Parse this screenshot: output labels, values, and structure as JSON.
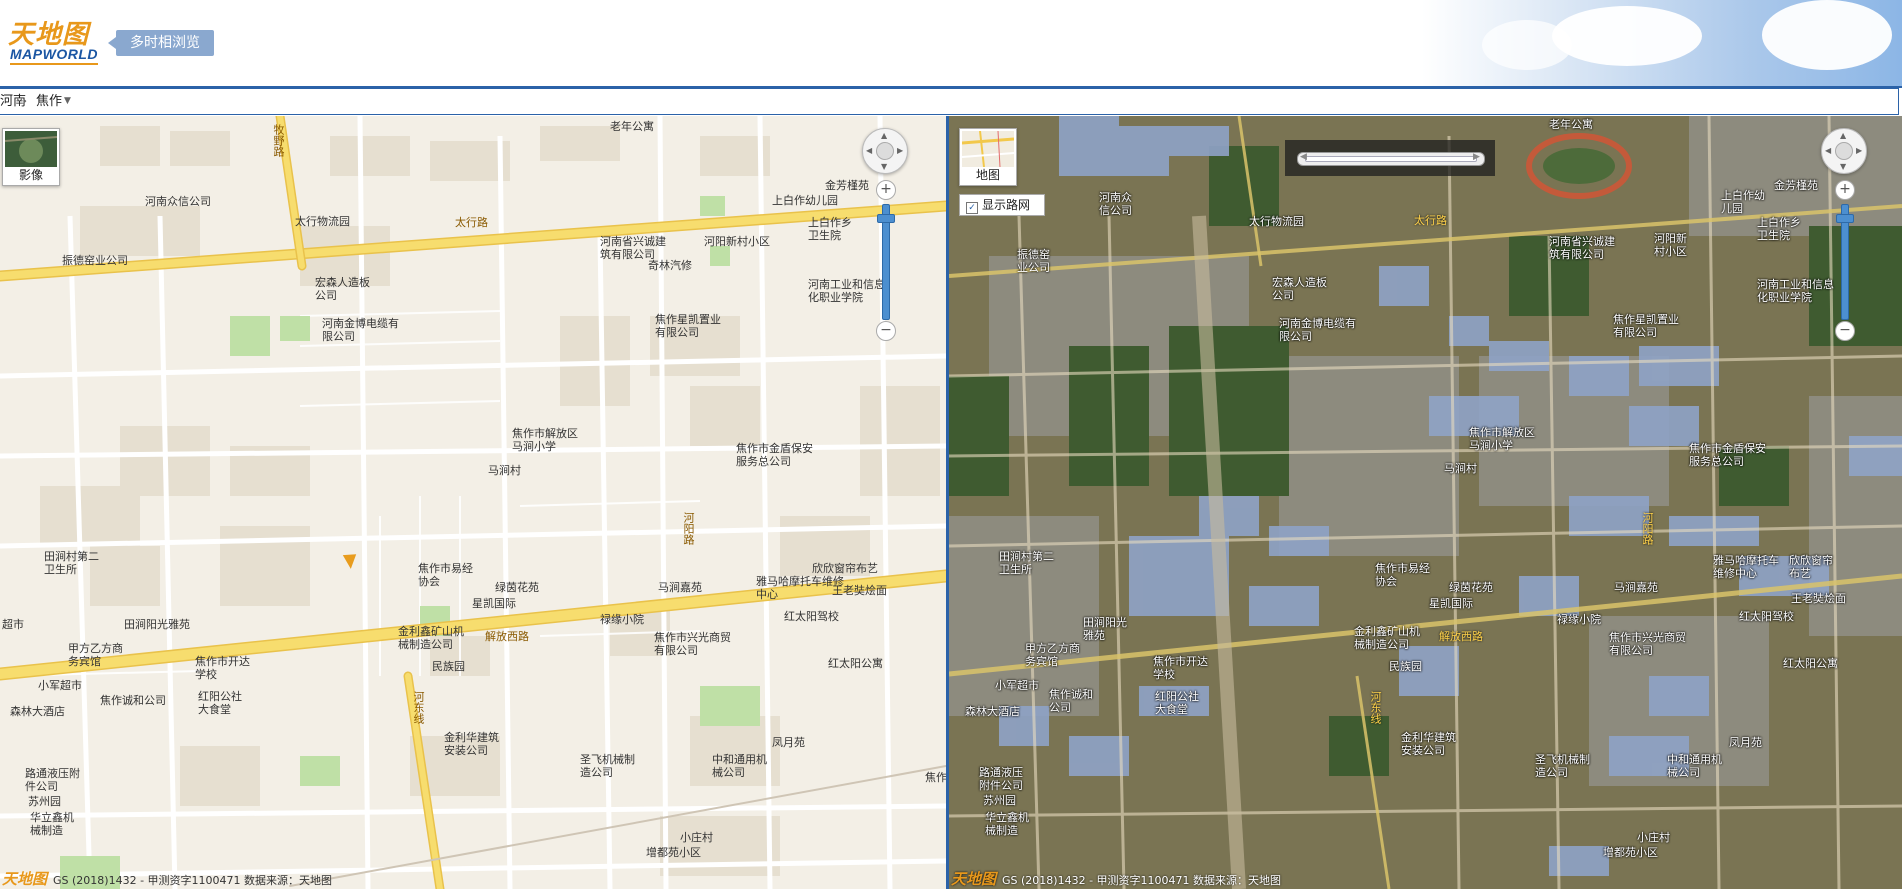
{
  "header": {
    "logo_cn": "天地图",
    "logo_en": "MAPWORLD",
    "subtitle": "多时相浏览"
  },
  "breadcrumb": {
    "province": "河南",
    "city": "焦作"
  },
  "left_map": {
    "layer_switch_label": "影像",
    "footer": "GS (2018)1432 - 甲测资字1100471 数据来源：天地图",
    "labels": [
      "老年公寓",
      "河南众信公司",
      "太行物流园",
      "振德窑业公司",
      "宏森人造板公司",
      "河南金博电缆有限公司",
      "河南省兴诚建筑有限公司",
      "河阳新村小区",
      "奇林汽修",
      "金芳槿苑",
      "上白作幼儿园",
      "上白作乡卫生院",
      "河南工业和信息化职业学院",
      "焦作星凯置业有限公司",
      "焦作市解放区马涧小学",
      "马涧村",
      "焦作市金盾保安服务总公司",
      "田涧村第二卫生所",
      "焦作市易经协会",
      "绿茵花苑",
      "星凯国际",
      "禄缘小院",
      "马涧嘉苑",
      "雅马哈摩托车维修中心",
      "欣欣窗帘布艺",
      "王老奘烩面",
      "超市",
      "田涧阳光雅苑",
      "甲方乙方商务宾馆",
      "焦作市开达学校",
      "金利鑫矿山机械制造公司",
      "民族园",
      "焦作市兴光商贸有限公司",
      "红太阳驾校",
      "红太阳公寓",
      "小军超市",
      "焦作诚和公司",
      "红阳公社大食堂",
      "森林大酒店",
      "金利华建筑安装公司",
      "圣飞机械制造公司",
      "中和通用机械公司",
      "凤月苑",
      "焦作",
      "路通液压附件公司",
      "苏州园",
      "华立鑫机械制造",
      "小庄村",
      "增都苑小区"
    ],
    "roads": [
      "太行路",
      "牧野路",
      "解放西路",
      "河阳路",
      "河东线"
    ]
  },
  "right_map": {
    "layer_switch_label": "地图",
    "road_toggle_label": "显示路网",
    "footer": "GS (2018)1432 - 甲测资字1100471 数据来源：天地图"
  }
}
